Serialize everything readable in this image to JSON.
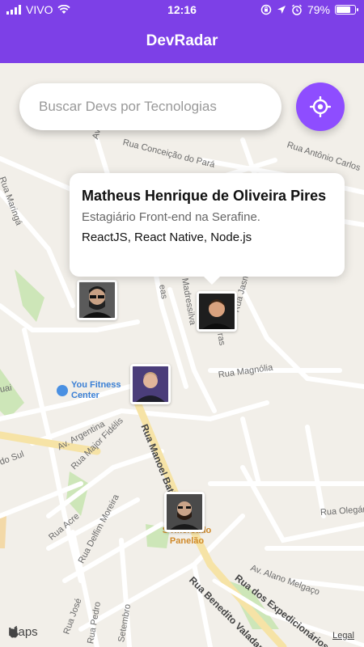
{
  "status_bar": {
    "carrier": "VIVO",
    "time": "12:16",
    "battery": "79%",
    "battery_level": 0.79,
    "icons": [
      "signal-bars-icon",
      "wifi-icon",
      "orientation-lock-icon",
      "location-arrow-icon",
      "alarm-icon",
      "battery-icon"
    ]
  },
  "header": {
    "title": "DevRadar"
  },
  "search": {
    "placeholder": "Buscar Devs por Tecnologias",
    "value": ""
  },
  "locate_button": {
    "icon": "target-icon"
  },
  "callout": {
    "name": "Matheus Henrique de Oliveira Pires",
    "bio": "Estagiário Front-end na Serafine.",
    "techs": "ReactJS, React Native, Node.js"
  },
  "map": {
    "streets": {
      "conceicao": "Rua Conceição do Pará",
      "antonio_carlos": "Rua Antônio Carlos",
      "maringa": "Rua Maringá",
      "av": "Av.",
      "jasmim": "Rua Jasmim",
      "magnolia": "Rua Magnólia",
      "madressilva": "Madressilva",
      "eas": "eas",
      "argentina": "Av. Argentina",
      "major_fidelis": "Rua Major Fidélis",
      "manoel_batista": "Rua Manoel Batista",
      "acre": "Rua Acre",
      "delfim_moreira": "Rua Delfim Moreira",
      "olegario": "Rua Olegário",
      "alano": "Av. Alano Melgaço",
      "expedicionarios": "Rua dos Expedicionários",
      "benedito": "Rua Benedito Valadares",
      "jose": "Rua José",
      "pedro": "Rua Pedro",
      "setembro": "Setembro",
      "do_sul": "do Sul",
      "uai": "uai",
      "ras": "ras"
    },
    "pois": {
      "gym": "You Fitness Center",
      "supermarket": "Supermercado Panelão",
      "supermarket_line1": "S     rmercado",
      "supermarket_line2": "Panelão"
    },
    "maps_label": "Maps",
    "legal": "Legal"
  }
}
